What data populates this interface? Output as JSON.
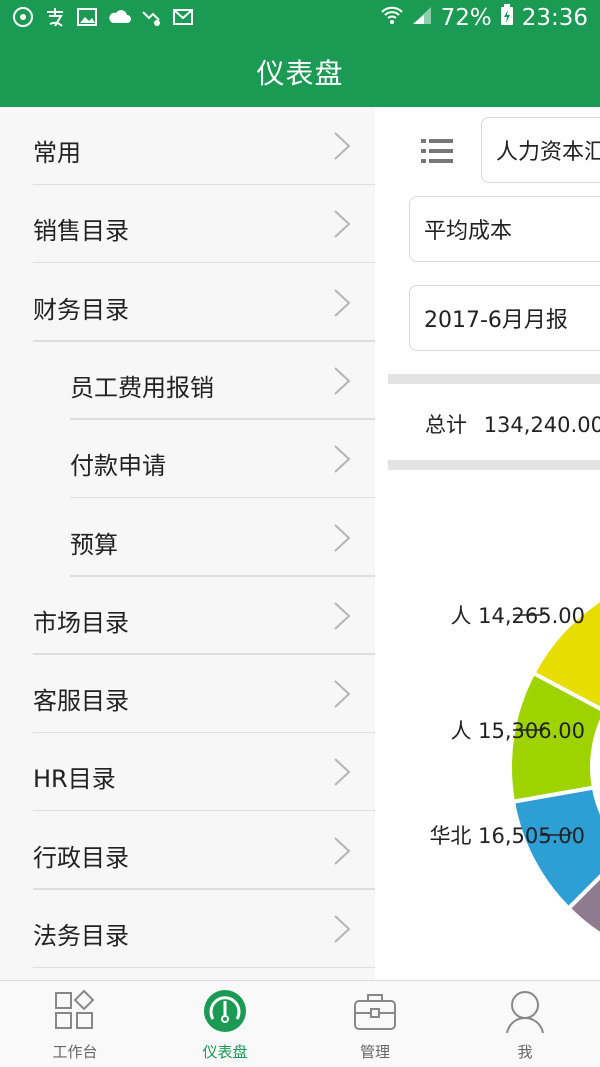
{
  "status_bar": {
    "battery": "72%",
    "time": "23:36"
  },
  "header": {
    "title": "仪表盘"
  },
  "dashboard": {
    "report_select": "人力资本汇",
    "metric_select": "平均成本",
    "period_select": "2017-6月月报",
    "total_label": "总计",
    "total_value": "134,240.00",
    "chart_data": {
      "type": "pie",
      "labels": [
        {
          "text": "人 14,265.00",
          "value": 14265.0
        },
        {
          "text": "人 15,306.00",
          "value": 15306.0
        },
        {
          "text": "华北 16,505.00",
          "value": 16505.0
        }
      ],
      "colors": [
        "#2e9fd4",
        "#9ed300",
        "#e8dd00",
        "#8e7b8e"
      ]
    }
  },
  "menu": {
    "items": [
      {
        "label": "常用",
        "indent": false
      },
      {
        "label": "销售目录",
        "indent": false
      },
      {
        "label": "财务目录",
        "indent": false
      },
      {
        "label": "员工费用报销",
        "indent": true
      },
      {
        "label": "付款申请",
        "indent": true
      },
      {
        "label": "预算",
        "indent": true
      },
      {
        "label": "市场目录",
        "indent": false
      },
      {
        "label": "客服目录",
        "indent": false
      },
      {
        "label": "HR目录",
        "indent": false
      },
      {
        "label": "行政目录",
        "indent": false
      },
      {
        "label": "法务目录",
        "indent": false
      }
    ]
  },
  "bottom_nav": {
    "items": [
      {
        "label": "工作台",
        "icon": "grid-icon"
      },
      {
        "label": "仪表盘",
        "icon": "gauge-icon",
        "active": true
      },
      {
        "label": "管理",
        "icon": "briefcase-icon"
      },
      {
        "label": "我",
        "icon": "person-icon"
      }
    ]
  },
  "colors": {
    "brand": "#1a9a52"
  }
}
